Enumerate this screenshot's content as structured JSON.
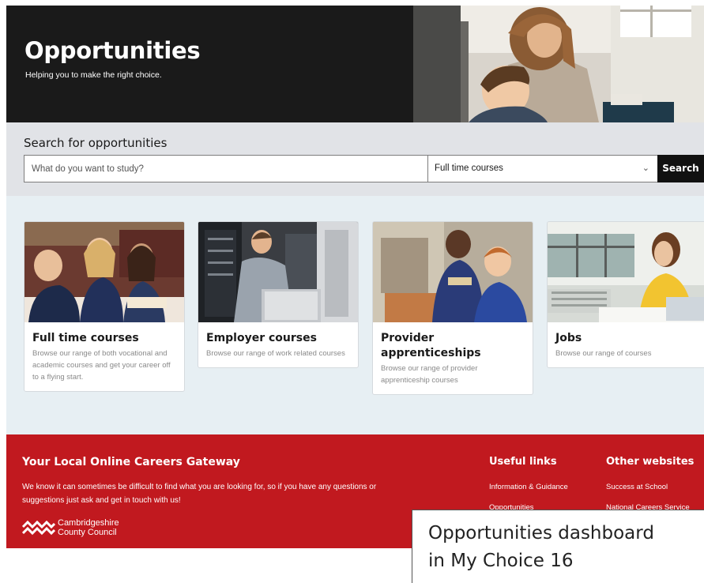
{
  "hero": {
    "title": "Opportunities",
    "subtitle": "Helping you to make the right choice."
  },
  "search": {
    "heading": "Search for opportunities",
    "placeholder": "What do you want to study?",
    "select_value": "Full time courses",
    "button_label": "Search"
  },
  "cards": [
    {
      "title": "Full time courses",
      "description": "Browse our range of both vocational and academic courses and get your career off to a flying start."
    },
    {
      "title": "Employer courses",
      "description": "Browse our range of work related courses"
    },
    {
      "title": "Provider apprenticeships",
      "description": "Browse our range of provider apprenticeship courses"
    },
    {
      "title": "Jobs",
      "description": "Browse our range of courses"
    }
  ],
  "footer": {
    "heading": "Your Local Online Careers Gateway",
    "text": "We know it can sometimes be difficult to find what you are looking for, so if you have any questions or suggestions just ask and get in touch with us!",
    "logo_line1": "Cambridgeshire",
    "logo_line2": "County Council",
    "useful_links": {
      "heading": "Useful links",
      "links": [
        "Information & Guidance",
        "Opportunities"
      ]
    },
    "other_websites": {
      "heading": "Other websites",
      "links": [
        "Success at School",
        "National Careers Service"
      ]
    }
  },
  "caption": {
    "line1": "Opportunities dashboard",
    "line2": "in My Choice 16"
  },
  "colors": {
    "hero_bg": "#1a1a1a",
    "search_bg": "#e1e3e7",
    "cards_bg": "#e7eff3",
    "footer_red": "#c1191f",
    "button_black": "#111111"
  },
  "icons": {
    "select_chevron": "chevron-down-icon",
    "logo": "cambridgeshire-logo-icon"
  }
}
